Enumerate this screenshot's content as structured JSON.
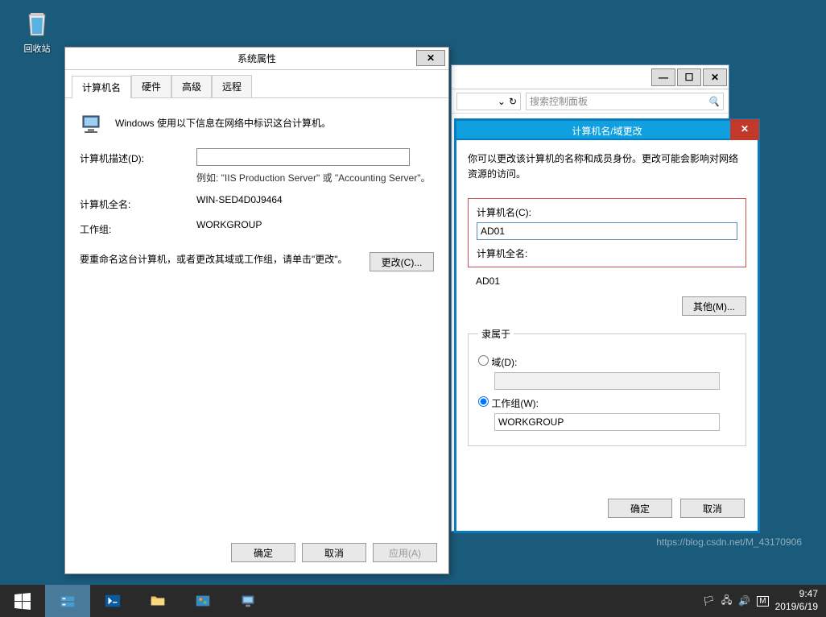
{
  "desktop": {
    "recycle_bin": "回收站"
  },
  "explorer": {
    "refresh": "↻",
    "dropdown": "⌄",
    "search_placeholder": "搜索控制面板",
    "search_icon": "🔍"
  },
  "sysprops": {
    "title": "系统属性",
    "tabs": {
      "computer_name": "计算机名",
      "hardware": "硬件",
      "advanced": "高级",
      "remote": "远程"
    },
    "intro": "Windows 使用以下信息在网络中标识这台计算机。",
    "desc_label": "计算机描述(D):",
    "desc_hint": "例如: \"IIS Production Server\" 或 \"Accounting Server\"。",
    "fullname_label": "计算机全名:",
    "fullname_value": "WIN-SED4D0J9464",
    "workgroup_label": "工作组:",
    "workgroup_value": "WORKGROUP",
    "change_hint": "要重命名这台计算机，或者更改其域或工作组，请单击\"更改\"。",
    "change_btn": "更改(C)...",
    "ok": "确定",
    "cancel": "取消",
    "apply": "应用(A)"
  },
  "rename": {
    "title": "计算机名/域更改",
    "hint": "你可以更改该计算机的名称和成员身份。更改可能会影响对网络资源的访问。",
    "name_label": "计算机名(C):",
    "name_value": "AD01",
    "fullname_label": "计算机全名:",
    "fullname_value": "AD01",
    "other_btn": "其他(M)...",
    "member_of": "隶属于",
    "domain_label": "域(D):",
    "domain_value": "",
    "workgroup_label": "工作组(W):",
    "workgroup_value": "WORKGROUP",
    "ok": "确定",
    "cancel": "取消"
  },
  "taskbar": {
    "time": "9:47",
    "date": "2019/6/19"
  },
  "watermark": "https://blog.csdn.net/M_43170906"
}
